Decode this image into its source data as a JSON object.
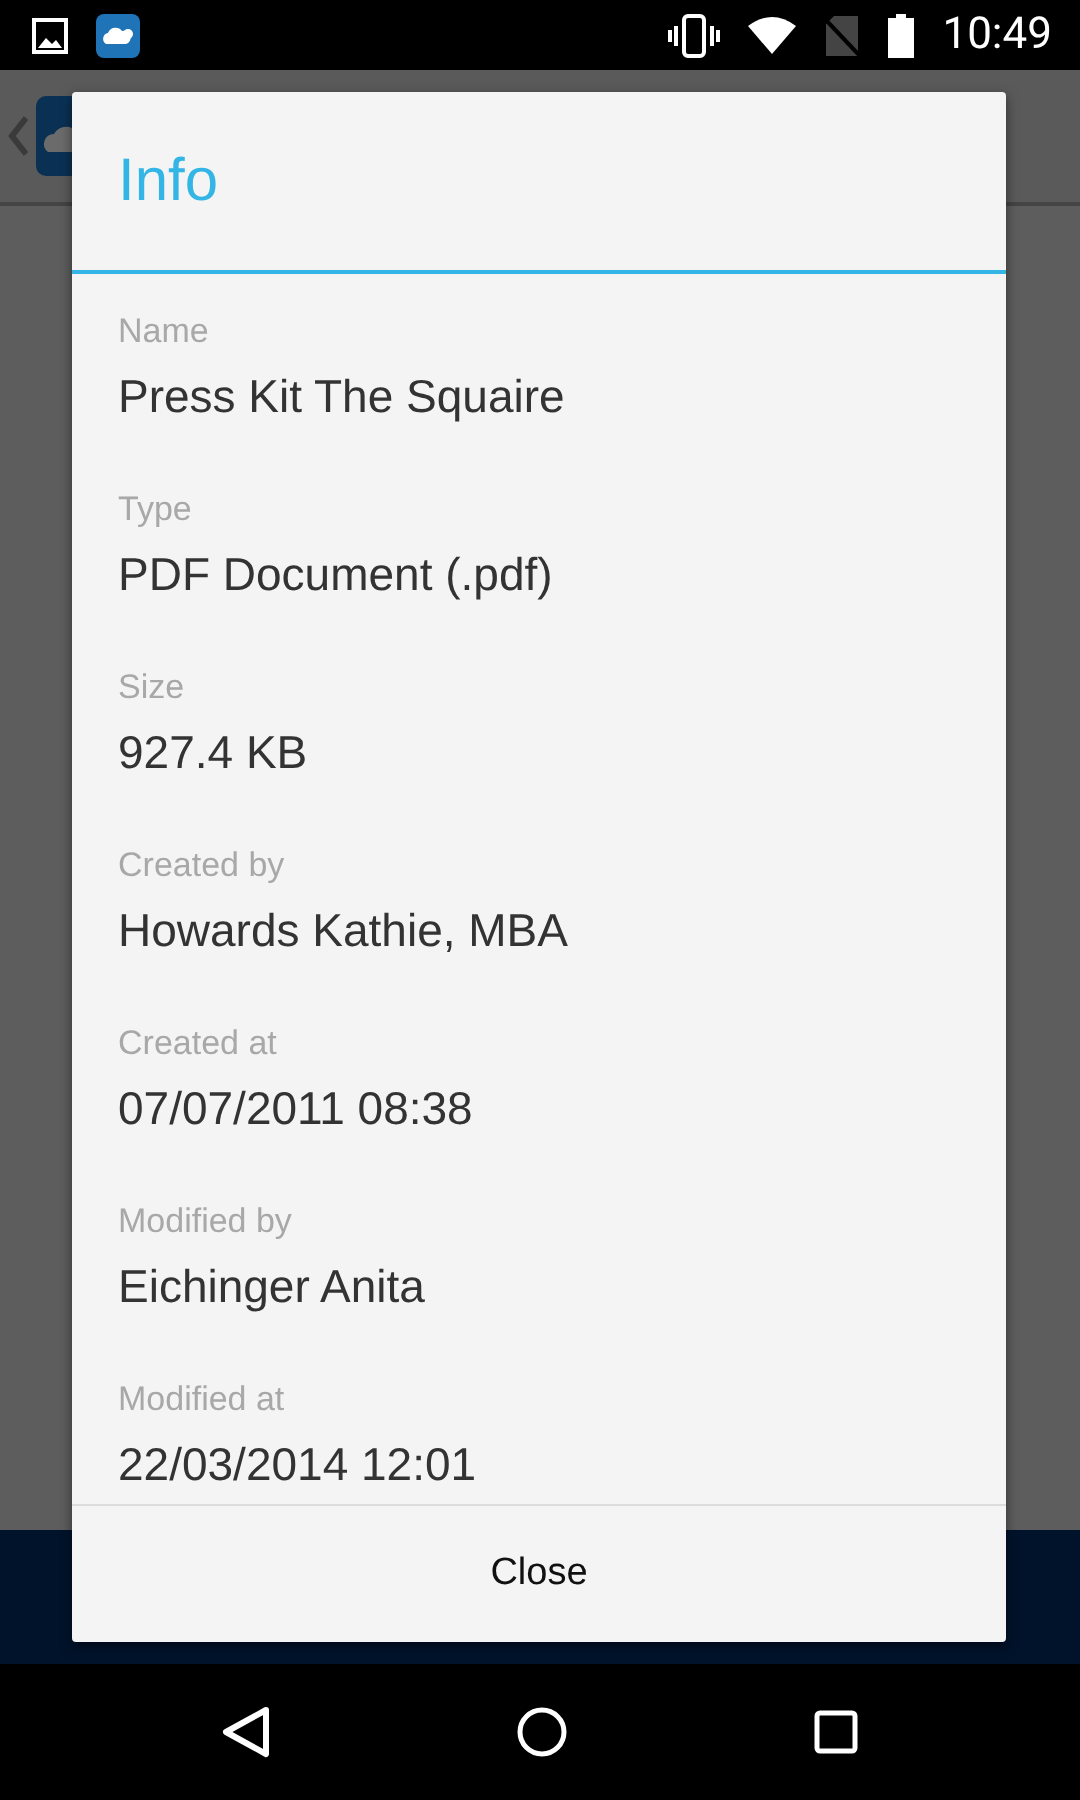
{
  "status_bar": {
    "time": "10:49"
  },
  "dialog": {
    "title": "Info",
    "fields": [
      {
        "label": "Name",
        "value": "Press Kit The Squaire"
      },
      {
        "label": "Type",
        "value": "PDF Document (.pdf)"
      },
      {
        "label": "Size",
        "value": "927.4 KB"
      },
      {
        "label": "Created by",
        "value": "Howards Kathie, MBA"
      },
      {
        "label": "Created at",
        "value": "07/07/2011 08:38"
      },
      {
        "label": "Modified by",
        "value": "Eichinger Anita"
      },
      {
        "label": "Modified at",
        "value": "22/03/2014 12:01"
      }
    ],
    "button": "Close"
  }
}
